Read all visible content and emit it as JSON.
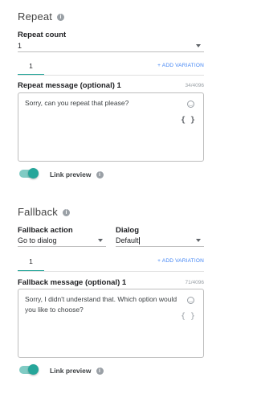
{
  "repeat": {
    "title": "Repeat",
    "count_label": "Repeat count",
    "count_value": "1",
    "tab_label": "1",
    "add_variation": "+ ADD VARIATION",
    "message_label": "Repeat message (optional) 1",
    "char_count": "34/4096",
    "message": "Sorry, can you repeat that please?",
    "braces": "{ }",
    "link_preview_label": "Link preview",
    "link_preview_on": true
  },
  "fallback": {
    "title": "Fallback",
    "action_label": "Fallback action",
    "action_value": "Go to dialog",
    "dialog_label": "Dialog",
    "dialog_value": "Default",
    "tab_label": "1",
    "add_variation": "+ ADD VARIATION",
    "message_label": "Fallback message (optional) 1",
    "char_count": "71/4096",
    "message": "Sorry, I didn't understand that. Which option would you like to choose?",
    "braces": "{ }",
    "link_preview_label": "Link preview",
    "link_preview_on": true
  },
  "icons": {
    "info": "info-icon",
    "emoji": "emoji-icon",
    "caret": "chevron-down-icon",
    "braces": "braces-icon"
  },
  "colors": {
    "accent": "#26a69a",
    "link": "#4285f4"
  }
}
